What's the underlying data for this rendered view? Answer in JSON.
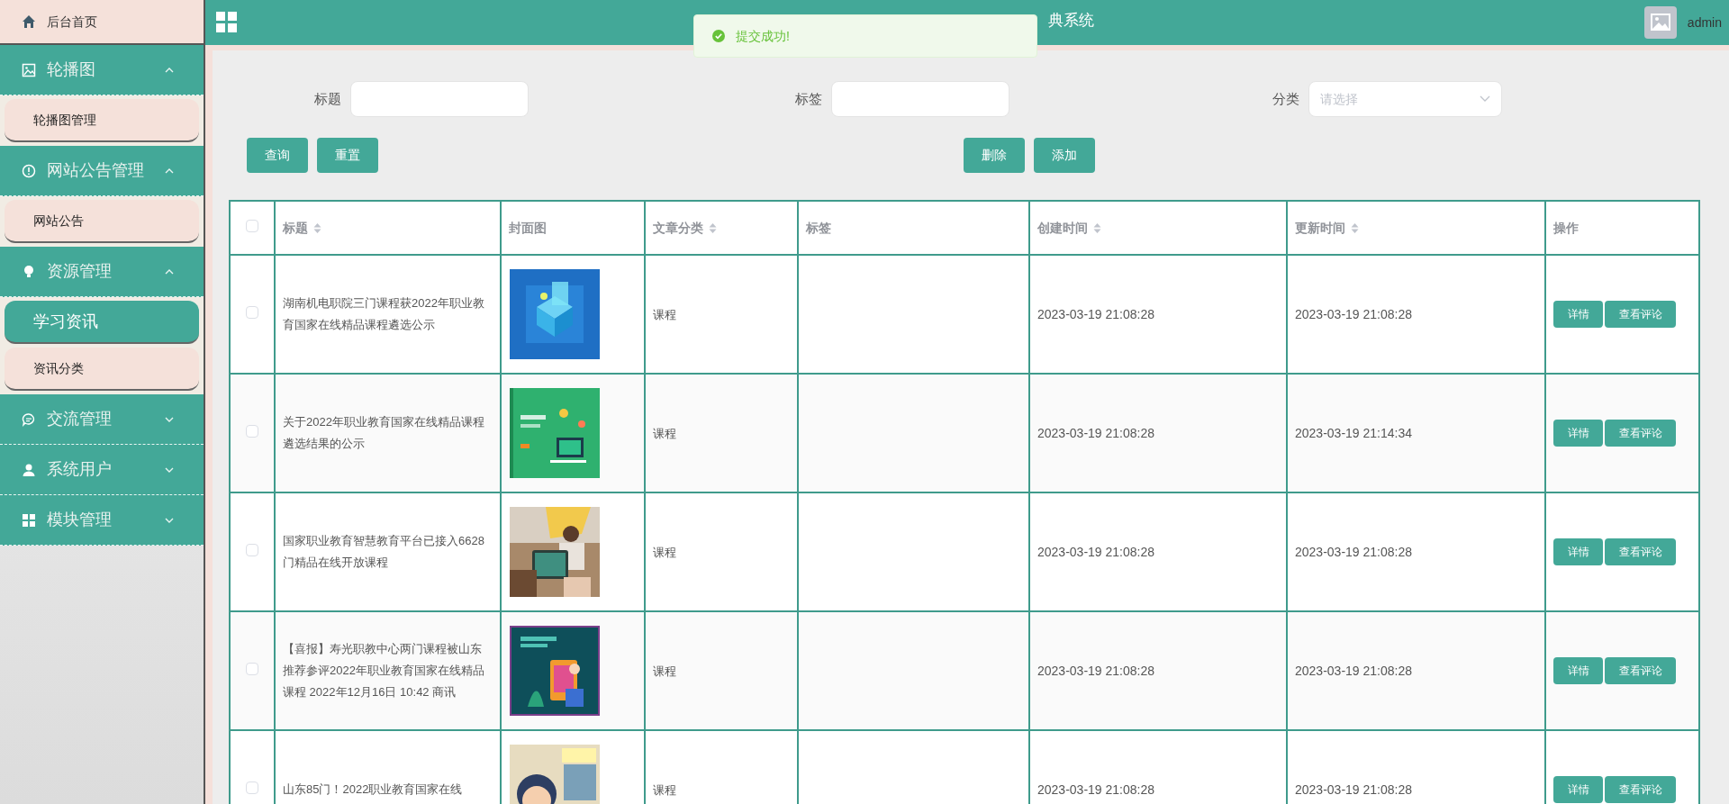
{
  "sidebar": {
    "items": [
      {
        "kind": "home",
        "label": "后台首页"
      },
      {
        "kind": "group",
        "label": "轮播图",
        "expanded": true,
        "children": [
          {
            "label": "轮播图管理",
            "selected": false
          }
        ]
      },
      {
        "kind": "group",
        "label": "网站公告管理",
        "expanded": true,
        "children": [
          {
            "label": "网站公告",
            "selected": false
          }
        ]
      },
      {
        "kind": "group",
        "label": "资源管理",
        "expanded": true,
        "children": [
          {
            "label": "学习资讯",
            "selected": true
          },
          {
            "label": "资讯分类",
            "selected": false
          }
        ]
      },
      {
        "kind": "group",
        "label": "交流管理",
        "expanded": false
      },
      {
        "kind": "group",
        "label": "系统用户",
        "expanded": false
      },
      {
        "kind": "group",
        "label": "模块管理",
        "expanded": false
      }
    ]
  },
  "header": {
    "title": "典系统",
    "user": "admin"
  },
  "toast": {
    "message": "提交成功!"
  },
  "search": {
    "fields": [
      {
        "kind": "text",
        "label": "标题"
      },
      {
        "kind": "text",
        "label": "标签"
      },
      {
        "kind": "select",
        "label": "分类",
        "placeholder": "请选择"
      }
    ],
    "left_buttons": [
      "查询",
      "重置"
    ],
    "right_buttons": [
      "删除",
      "添加"
    ]
  },
  "table": {
    "select_all": {
      "checked": false
    },
    "columns": [
      {
        "label": "标题",
        "sortable": true
      },
      {
        "label": "封面图",
        "sortable": false
      },
      {
        "label": "文章分类",
        "sortable": true
      },
      {
        "label": "标签",
        "sortable": false
      },
      {
        "label": "创建时间",
        "sortable": true
      },
      {
        "label": "更新时间",
        "sortable": true
      },
      {
        "label": "操作",
        "sortable": false
      }
    ],
    "rows": [
      {
        "checked": false,
        "title": "湖南机电职院三门课程获2022年职业教育国家在线精品课程遴选公示",
        "category": "课程",
        "created": "2023-03-19 21:08:28",
        "updated": "2023-03-19 21:08:28",
        "actions": [
          "详情",
          "查看评论"
        ]
      },
      {
        "checked": false,
        "title": "关于2022年职业教育国家在线精品课程遴选结果的公示",
        "category": "课程",
        "created": "2023-03-19 21:08:28",
        "updated": "2023-03-19 21:14:34",
        "actions": [
          "详情",
          "查看评论"
        ]
      },
      {
        "checked": false,
        "title": "国家职业教育智慧教育平台已接入6628门精品在线开放课程",
        "category": "课程",
        "created": "2023-03-19 21:08:28",
        "updated": "2023-03-19 21:08:28",
        "actions": [
          "详情",
          "查看评论"
        ]
      },
      {
        "checked": false,
        "title": "【喜报】寿光职教中心两门课程被山东推荐参评2022年职业教育国家在线精品课程 2022年12月16日 10:42 商讯",
        "category": "课程",
        "created": "2023-03-19 21:08:28",
        "updated": "2023-03-19 21:08:28",
        "actions": [
          "详情",
          "查看评论"
        ]
      },
      {
        "checked": false,
        "title": "山东85门！2022职业教育国家在线",
        "category": "课程",
        "created": "2023-03-19 21:08:28",
        "updated": "2023-03-19 21:08:28",
        "actions": [
          "详情",
          "查看评论"
        ]
      }
    ]
  }
}
